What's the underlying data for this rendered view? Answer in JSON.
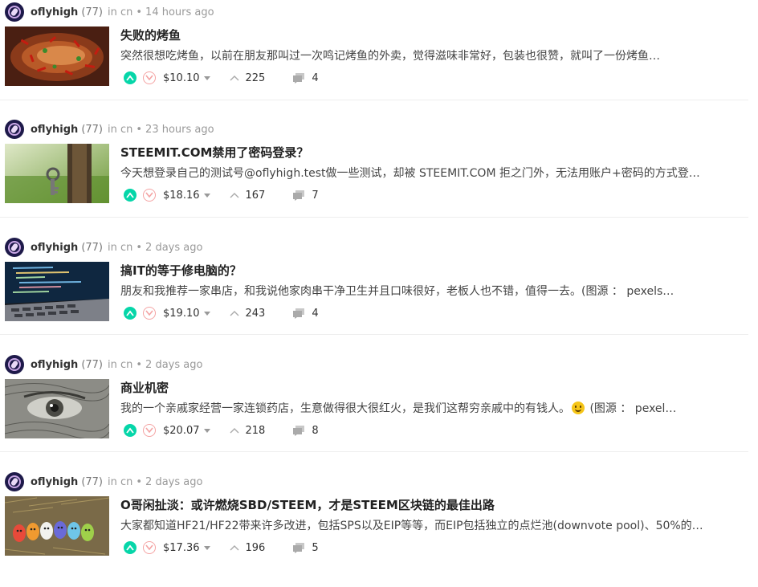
{
  "posts": [
    {
      "author": "oflyhigh",
      "reputation": "(77)",
      "category": "in cn",
      "age": "14 hours ago",
      "title": "失败的烤鱼",
      "excerpt": "突然很想吃烤鱼，以前在朋友那叫过一次鸣记烤鱼的外卖，觉得滋味非常好，包装也很赞，就叫了一份烤鱼…",
      "payout": "$10.10",
      "votes": "225",
      "comments": "4",
      "thumbnail": "grilled-fish-photo"
    },
    {
      "author": "oflyhigh",
      "reputation": "(77)",
      "category": "in cn",
      "age": "23 hours ago",
      "title": "STEEMIT.COM禁用了密码登录？",
      "excerpt": "今天想登录自己的测试号@oflyhigh.test做一些测试，却被 STEEMIT.COM 拒之门外，无法用账户+密码的方式登…",
      "payout": "$18.16",
      "votes": "167",
      "comments": "7",
      "thumbnail": "door-key-photo"
    },
    {
      "author": "oflyhigh",
      "reputation": "(77)",
      "category": "in cn",
      "age": "2 days ago",
      "title": "搞IT的等于修电脑的？",
      "excerpt": "朋友和我推荐一家串店，和我说他家肉串干净卫生并且口味很好，老板人也不错，值得一去。(图源 ： pexels…",
      "payout": "$19.10",
      "votes": "243",
      "comments": "4",
      "thumbnail": "laptop-code-photo"
    },
    {
      "author": "oflyhigh",
      "reputation": "(77)",
      "category": "in cn",
      "age": "2 days ago",
      "title": "商业机密",
      "excerpt_before": "我的一个亲戚家经营一家连锁药店，生意做得很大很红火，是我们这帮穷亲戚中的有钱人。",
      "excerpt_after": " (图源 ： pexel…",
      "emoji": "grinning-face-emoji",
      "payout": "$20.07",
      "votes": "218",
      "comments": "8",
      "thumbnail": "banknote-eye-photo"
    },
    {
      "author": "oflyhigh",
      "reputation": "(77)",
      "category": "in cn",
      "age": "2 days ago",
      "title": "O哥闲扯淡：或许燃烧SBD/STEEM，才是STEEM区块链的最佳出路",
      "excerpt": "大家都知道HF21/HF22带来许多改进，包括SPS以及EIP等等，而EIP包括独立的点烂池(downvote pool)、50%的…",
      "payout": "$17.36",
      "votes": "196",
      "comments": "5",
      "thumbnail": "painted-eggs-photo"
    }
  ],
  "colors": {
    "upvote": "#06d6a9",
    "downvote_border": "#f4a3a3",
    "meta": "#999999"
  }
}
